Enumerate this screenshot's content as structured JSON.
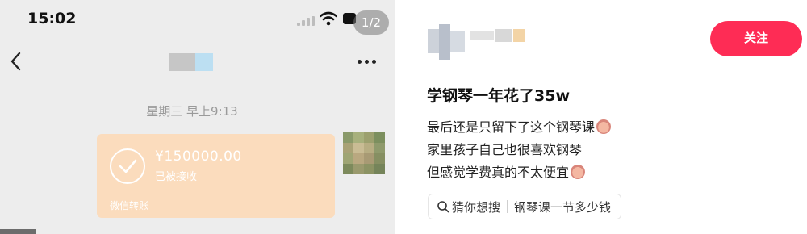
{
  "phone": {
    "status_time": "15:02",
    "page_indicator": "1/2",
    "chat_time": "星期三 早上9:13",
    "transfer": {
      "amount": "¥150000.00",
      "status": "已被接收",
      "footer": "微信转账"
    }
  },
  "post": {
    "follow_label": "关注",
    "title": "学钢琴一年花了35w",
    "body_lines": [
      "最后还是只留下了这个钢琴课",
      "家里孩子自己也很喜欢钢琴",
      "但感觉学费真的不太便宜"
    ],
    "search_tag": {
      "prefix": "猜你想搜",
      "query": "钢琴课一节多少钱"
    }
  },
  "colors": {
    "follow": "#fe2c55",
    "transfer_card": "#fbdcbd",
    "chat_bg": "#ededed"
  }
}
